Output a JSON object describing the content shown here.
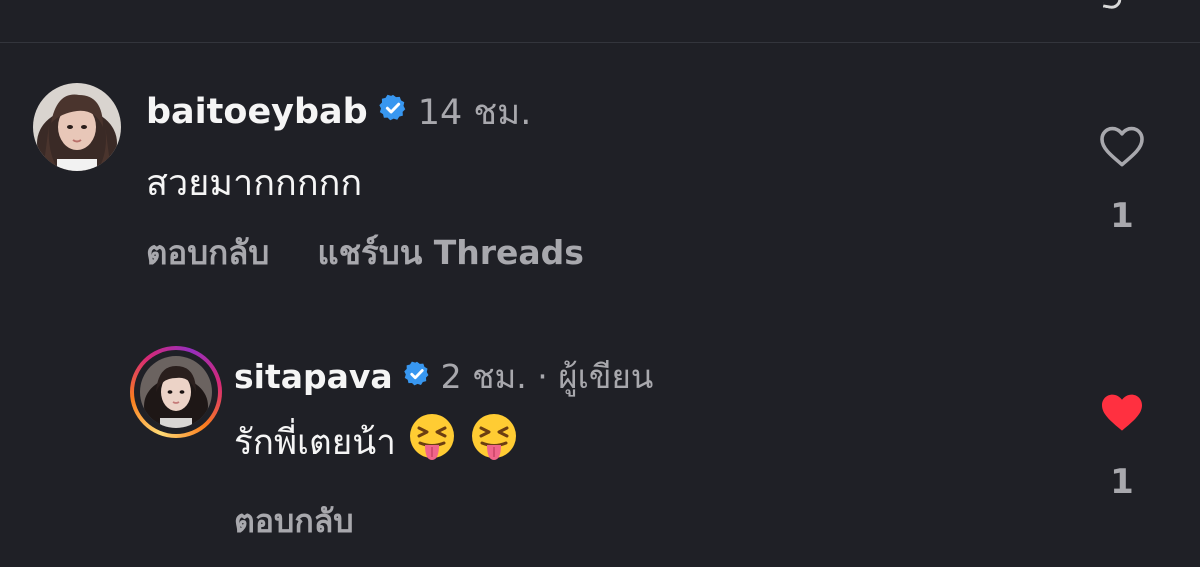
{
  "comments": [
    {
      "username": "baitoeybab",
      "verified": true,
      "time": "14 ชม.",
      "text": "สวยมากกกกก",
      "actions": [
        "ตอบกลับ",
        "แชร์บน Threads"
      ],
      "liked": false,
      "like_count": "1"
    },
    {
      "username": "sitapava",
      "verified": true,
      "time": "2 ชม. · ผู้เขียน",
      "text": "รักพี่เตยน้า",
      "emojis": [
        "squinting-face-with-tongue",
        "squinting-face-with-tongue"
      ],
      "actions": [
        "ตอบกลับ"
      ],
      "liked": true,
      "like_count": "1",
      "has_story_ring": true
    }
  ],
  "colors": {
    "background": "#1f2026",
    "verified_badge": "#3897f0",
    "like_active": "#ff3040",
    "secondary_text": "#a8a8ad"
  }
}
